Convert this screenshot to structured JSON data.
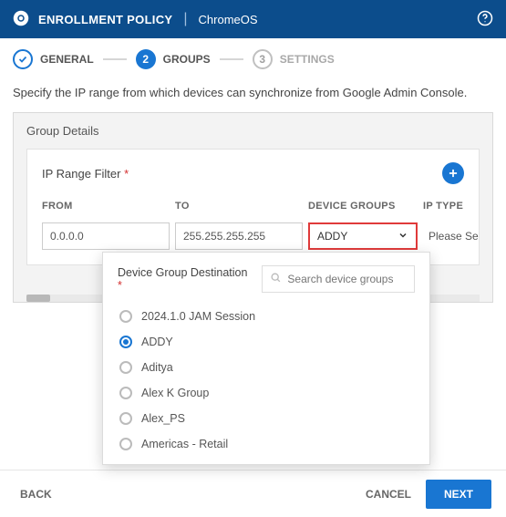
{
  "header": {
    "title": "ENROLLMENT POLICY",
    "subtitle": "ChromeOS"
  },
  "stepper": {
    "steps": [
      {
        "label": "GENERAL",
        "state": "done"
      },
      {
        "num": "2",
        "label": "GROUPS",
        "state": "active"
      },
      {
        "num": "3",
        "label": "SETTINGS",
        "state": "inactive"
      }
    ]
  },
  "description": "Specify the IP range from which devices can synchronize from Google Admin Console.",
  "panel": {
    "title": "Group Details",
    "card_title": "IP Range Filter",
    "columns": {
      "from": "FROM",
      "to": "TO",
      "device_groups": "DEVICE GROUPS",
      "ip_type": "IP TYPE"
    },
    "row": {
      "from": "0.0.0.0",
      "to": "255.255.255.255",
      "device_group_selected": "ADDY",
      "ip_type": "Please Se"
    }
  },
  "dropdown": {
    "title": "Device Group Destination",
    "search_placeholder": "Search device groups",
    "options": [
      {
        "label": "2024.1.0 JAM Session",
        "selected": false
      },
      {
        "label": "ADDY",
        "selected": true
      },
      {
        "label": "Aditya",
        "selected": false
      },
      {
        "label": "Alex K Group",
        "selected": false
      },
      {
        "label": "Alex_PS",
        "selected": false
      },
      {
        "label": "Americas - Retail",
        "selected": false
      }
    ]
  },
  "footer": {
    "back": "BACK",
    "cancel": "CANCEL",
    "next": "NEXT"
  }
}
